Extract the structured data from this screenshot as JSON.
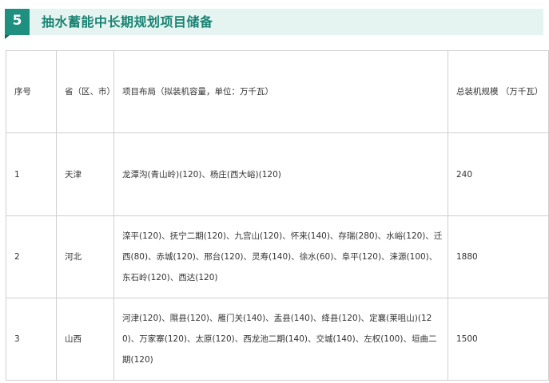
{
  "section": {
    "number": "5",
    "title": "抽水蓄能中长期规划项目储备"
  },
  "table": {
    "headers": {
      "seq": "序号",
      "province": "省（区、市）",
      "layout": "项目布局（拟装机容量，单位：万千瓦）",
      "total": "总装机规模 （万千瓦）"
    },
    "rows": [
      {
        "seq": "1",
        "province": "天津",
        "layout": "龙潭沟(青山岭)(120)、杨庄(西大峪)(120)",
        "total": "240"
      },
      {
        "seq": "2",
        "province": "河北",
        "layout": "滦平(120)、抚宁二期(120)、九宫山(120)、怀来(140)、存瑞(280)、水峪(120)、迁西(80)、赤城(120)、邢台(120)、灵寿(140)、徐水(60)、阜平(120)、涞源(100)、东石岭(120)、西达(120)",
        "total": "1880"
      },
      {
        "seq": "3",
        "province": "山西",
        "layout": "河津(120)、隰县(120)、雁门关(140)、盂县(140)、绛县(120)、定襄(莱咀山)(120)、万家寨(120)、太原(120)、西龙池二期(140)、交城(140)、左权(100)、垣曲二期(120)",
        "total": "1500"
      }
    ]
  }
}
